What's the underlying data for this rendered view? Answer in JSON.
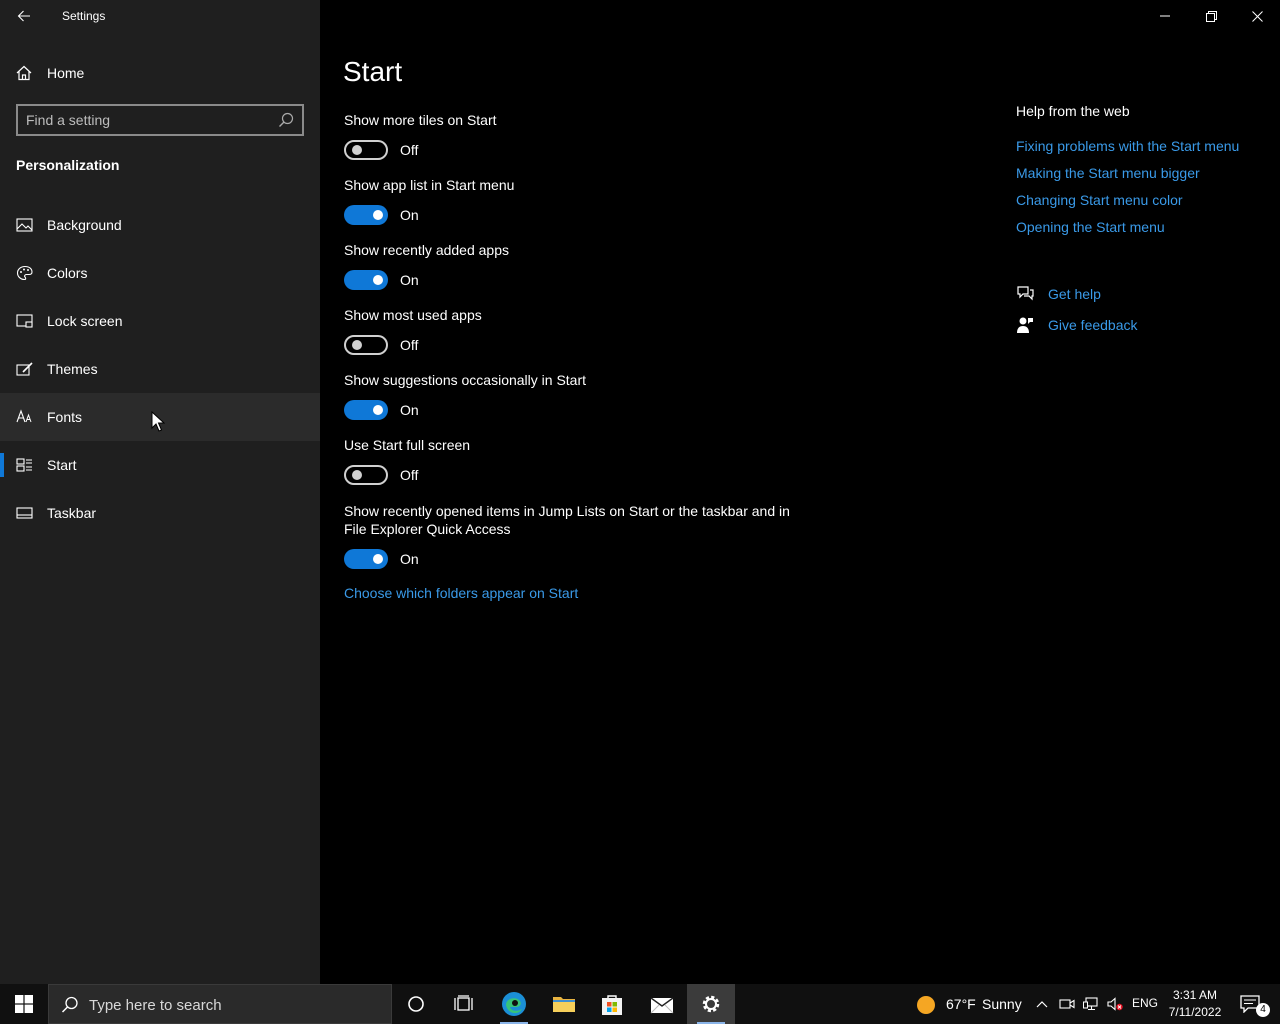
{
  "window": {
    "title": "Settings"
  },
  "sidebar": {
    "home_label": "Home",
    "search_placeholder": "Find a setting",
    "section_title": "Personalization",
    "items": [
      {
        "label": "Background",
        "icon": "image-icon"
      },
      {
        "label": "Colors",
        "icon": "palette-icon"
      },
      {
        "label": "Lock screen",
        "icon": "lock-screen-icon"
      },
      {
        "label": "Themes",
        "icon": "themes-icon"
      },
      {
        "label": "Fonts",
        "icon": "fonts-icon"
      },
      {
        "label": "Start",
        "icon": "start-icon"
      },
      {
        "label": "Taskbar",
        "icon": "taskbar-icon"
      }
    ]
  },
  "main": {
    "title": "Start",
    "settings": [
      {
        "label": "Show more tiles on Start",
        "state": "Off"
      },
      {
        "label": "Show app list in Start menu",
        "state": "On"
      },
      {
        "label": "Show recently added apps",
        "state": "On"
      },
      {
        "label": "Show most used apps",
        "state": "Off"
      },
      {
        "label": "Show suggestions occasionally in Start",
        "state": "On"
      },
      {
        "label": "Use Start full screen",
        "state": "Off"
      },
      {
        "label": "Show recently opened items in Jump Lists on Start or the taskbar and in File Explorer Quick Access",
        "state": "On"
      }
    ],
    "folders_link": "Choose which folders appear on Start"
  },
  "help": {
    "title": "Help from the web",
    "links": [
      "Fixing problems with the Start menu",
      "Making the Start menu bigger",
      "Changing Start menu color",
      "Opening the Start menu"
    ],
    "get_help": "Get help",
    "give_feedback": "Give feedback"
  },
  "taskbar": {
    "search_placeholder": "Type here to search",
    "weather": {
      "temp": "67°F",
      "condition": "Sunny"
    },
    "language": "ENG",
    "time": "3:31 AM",
    "date": "7/11/2022",
    "notification_count": "4"
  },
  "colors": {
    "accent": "#0f78d7",
    "link": "#3a9ae8",
    "sidebar_bg": "#1f1f1f",
    "main_bg": "#000000"
  }
}
